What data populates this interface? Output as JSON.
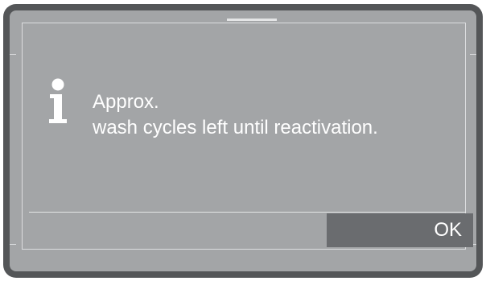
{
  "dialog": {
    "line1": "Approx.",
    "line2": "wash cycles left until reactivation.",
    "ok_label": "OK",
    "icon": "info-icon"
  },
  "colors": {
    "frame": "#545658",
    "screen": "#a3a5a7",
    "button": "#6a6c6f",
    "text": "#ffffff"
  }
}
